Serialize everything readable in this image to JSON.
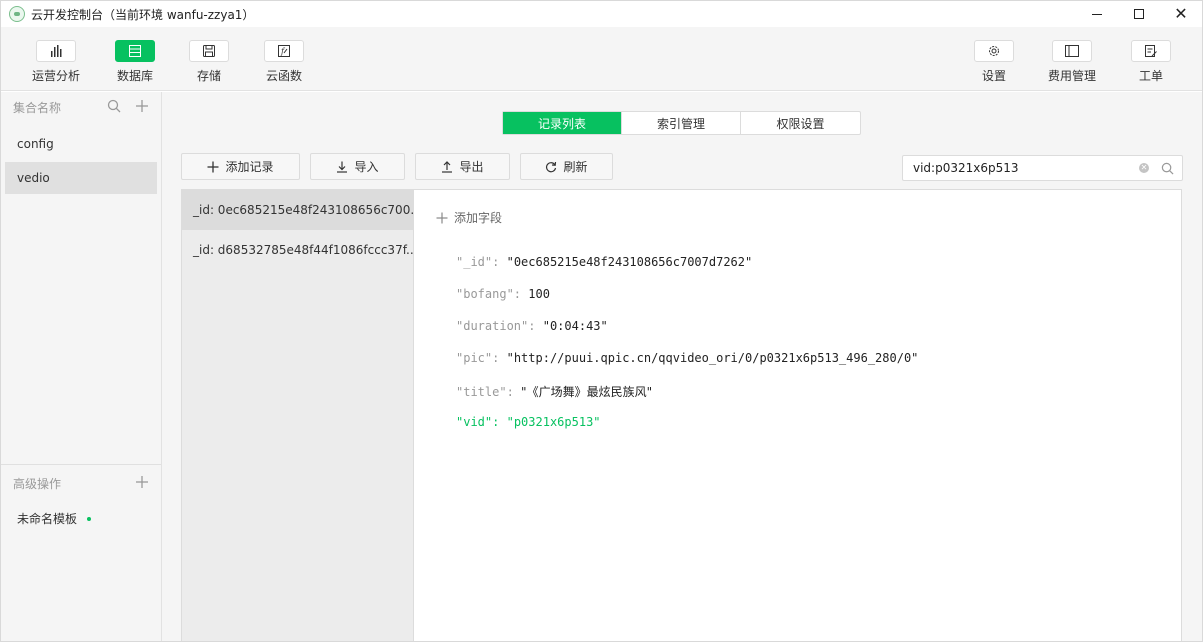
{
  "window": {
    "title": "云开发控制台（当前环境 wanfu-zzya1）",
    "controls": {
      "minimize": "—",
      "maximize": "☐",
      "close": "✕"
    }
  },
  "toolbar": {
    "left": [
      {
        "label": "运营分析",
        "icon": "bar-chart-icon",
        "active": false
      },
      {
        "label": "数据库",
        "icon": "database-icon",
        "active": true
      },
      {
        "label": "存储",
        "icon": "storage-icon",
        "active": false
      },
      {
        "label": "云函数",
        "icon": "cloud-function-icon",
        "active": false
      }
    ],
    "right": [
      {
        "label": "设置",
        "icon": "gear-icon"
      },
      {
        "label": "费用管理",
        "icon": "billing-icon"
      },
      {
        "label": "工单",
        "icon": "ticket-icon"
      }
    ]
  },
  "sidebar": {
    "header": "集合名称",
    "items": [
      {
        "label": "config",
        "active": false
      },
      {
        "label": "vedio",
        "active": true
      }
    ],
    "advanced_header": "高级操作",
    "template_label": "未命名模板"
  },
  "tabs": [
    {
      "label": "记录列表",
      "active": true
    },
    {
      "label": "索引管理",
      "active": false
    },
    {
      "label": "权限设置",
      "active": false
    }
  ],
  "actions": {
    "add_record": "添加记录",
    "import": "导入",
    "export": "导出",
    "refresh": "刷新"
  },
  "search": {
    "value": "vid:p0321x6p513"
  },
  "records": [
    {
      "label": "_id: 0ec685215e48f243108656c700..."
    },
    {
      "label": "_id: d68532785e48f44f1086fccc37f..."
    }
  ],
  "detail": {
    "add_field": "添加字段",
    "fields": [
      {
        "key": "\"_id\"",
        "value": "\"0ec685215e48f243108656c7007d7262\""
      },
      {
        "key": "\"bofang\"",
        "value": "100"
      },
      {
        "key": "\"duration\"",
        "value": "\"0:04:43\""
      },
      {
        "key": "\"pic\"",
        "value": "\"http://puui.qpic.cn/qqvideo_ori/0/p0321x6p513_496_280/0\""
      },
      {
        "key": "\"title\"",
        "value": "\"《广场舞》最炫民族风\""
      },
      {
        "key": "\"vid\"",
        "value": "\"p0321x6p513\""
      }
    ],
    "separator": ":"
  },
  "colors": {
    "accent": "#07c160",
    "sidebar_bg": "#f5f5f5",
    "text": "#333333"
  }
}
